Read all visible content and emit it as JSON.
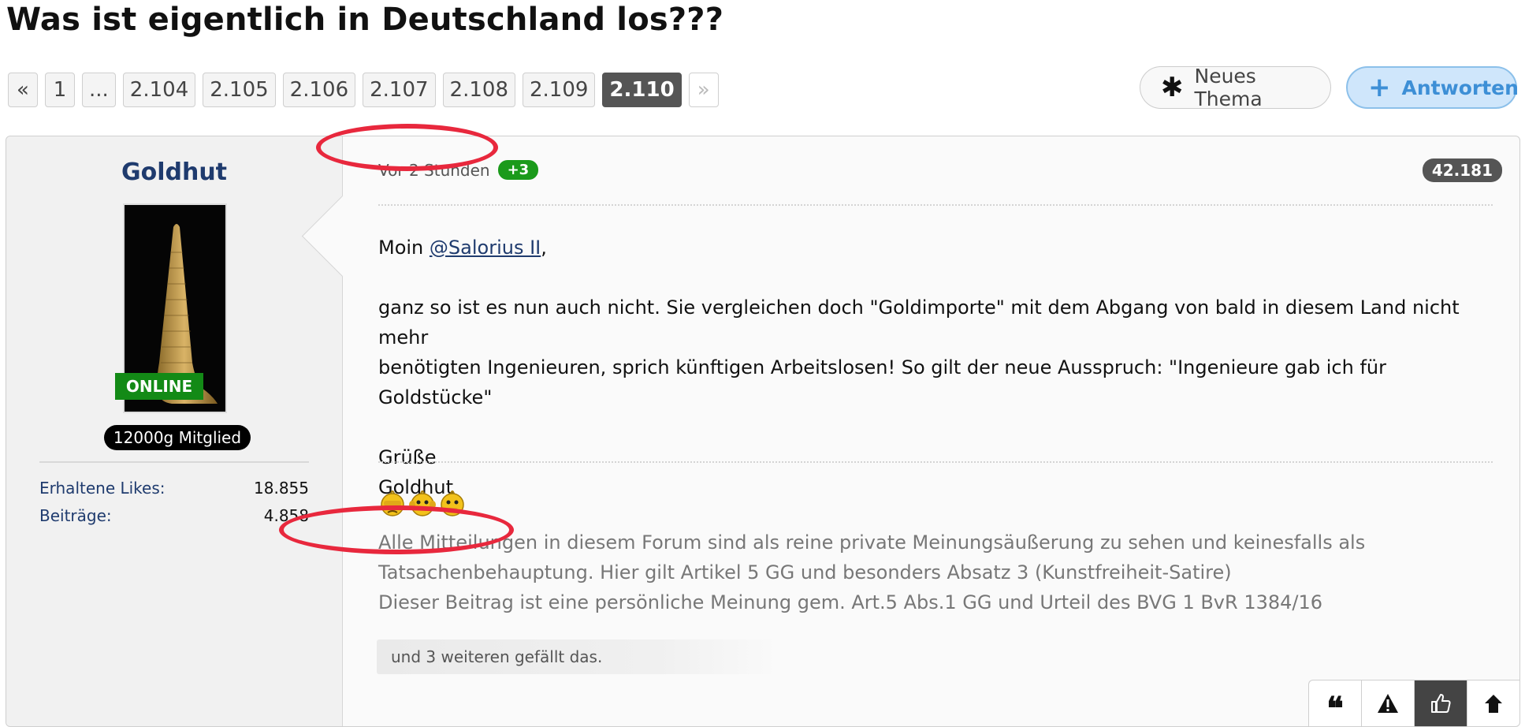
{
  "thread": {
    "title": "Was ist eigentlich in Deutschland los???"
  },
  "pagination": {
    "first": "«",
    "pages": [
      "1",
      "...",
      "2.104",
      "2.105",
      "2.106",
      "2.107",
      "2.108",
      "2.109",
      "2.110"
    ],
    "current": "2.110",
    "next": "»"
  },
  "actions": {
    "new_thread": "Neues Thema",
    "reply": "Antworten"
  },
  "author": {
    "name": "Goldhut",
    "status": "ONLINE",
    "rank": "12000g Mitglied",
    "stats": [
      {
        "label": "Erhaltene Likes:",
        "value": "18.855"
      },
      {
        "label": "Beiträge:",
        "value": "4.858"
      }
    ]
  },
  "post": {
    "time": "Vor 2 Stunden",
    "reactions": "+3",
    "number": "42.181",
    "greeting": "Moin ",
    "mention": "@Salorius II",
    "greeting_end": ",",
    "body_line1": "ganz so ist es nun auch nicht. Sie vergleichen doch \"Goldimporte\" mit dem Abgang von bald in diesem Land nicht mehr",
    "body_line2": "benötigten Ingenieuren, sprich künftigen Arbeitslosen! So gilt der neue Ausspruch: \"Ingenieure gab ich für Goldstücke\"",
    "closing": "Grüße",
    "sign_name": "Goldhut",
    "signature": [
      "Alle Mitteilungen in diesem Forum sind als reine private Meinungsäußerung zu sehen und keinesfalls als",
      "Tatsachenbehauptung. Hier gilt Artikel 5 GG und besonders Absatz 3 (Kunstfreiheit-Satire)",
      "Dieser Beitrag ist eine persönliche Meinung gem. Art.5 Abs.1 GG und Urteil des BVG 1 BvR 1384/16"
    ],
    "likes_text": "und 3 weiteren gefällt das."
  },
  "post_actions": [
    "quote-icon",
    "warning-icon",
    "thumbs-up-icon",
    "arrow-up-icon"
  ],
  "colors": {
    "accent": "#1f3b6e",
    "online": "#138a16",
    "highlight": "#e8283d",
    "reply": "#3d8fd6"
  }
}
